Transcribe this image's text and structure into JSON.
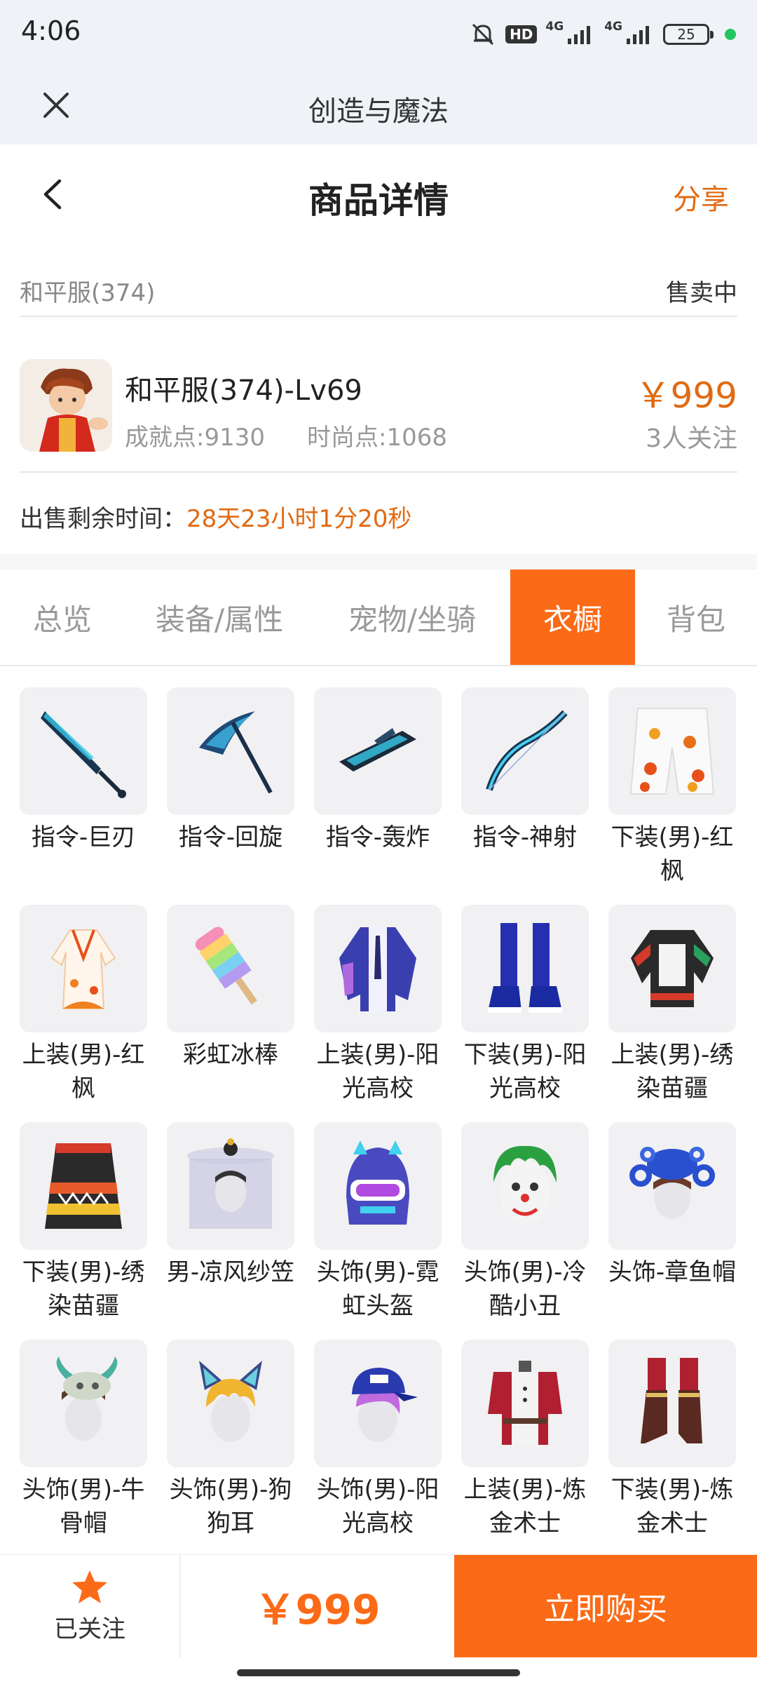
{
  "status_bar": {
    "time": "4:06",
    "hd_label": "HD",
    "network_1": "4G",
    "network_2": "4G",
    "battery": "25"
  },
  "web": {
    "title": "创造与魔法"
  },
  "header": {
    "title": "商品详情",
    "share_label": "分享"
  },
  "server": {
    "name": "和平服(374)",
    "status": "售卖中"
  },
  "product": {
    "name": "和平服(374)-Lv69",
    "achievement": "成就点:9130",
    "fashion": "时尚点:1068",
    "price": "￥999",
    "watchers": "3人关注"
  },
  "remaining": {
    "label": "出售剩余时间：",
    "value": "28天23小时1分20秒"
  },
  "tabs": [
    {
      "label": "总览"
    },
    {
      "label": "装备/属性"
    },
    {
      "label": "宠物/坐骑"
    },
    {
      "label": "衣橱"
    },
    {
      "label": "背包"
    }
  ],
  "items": [
    {
      "name": "指令-巨刃",
      "icon": "blade-icon"
    },
    {
      "name": "指令-回旋",
      "icon": "scythe-icon"
    },
    {
      "name": "指令-轰炸",
      "icon": "bomber-icon"
    },
    {
      "name": "指令-神射",
      "icon": "bow-icon"
    },
    {
      "name": "下装(男)-红枫",
      "icon": "maple-shorts-icon"
    },
    {
      "name": "上装(男)-红枫",
      "icon": "maple-robe-icon"
    },
    {
      "name": "彩虹冰棒",
      "icon": "rainbow-popsicle-icon"
    },
    {
      "name": "上装(男)-阳光高校",
      "icon": "school-jacket-icon"
    },
    {
      "name": "下装(男)-阳光高校",
      "icon": "school-boots-icon"
    },
    {
      "name": "上装(男)-绣染苗疆",
      "icon": "miao-top-icon"
    },
    {
      "name": "下装(男)-绣染苗疆",
      "icon": "miao-skirt-icon"
    },
    {
      "name": "男-凉风纱笠",
      "icon": "veil-hat-icon"
    },
    {
      "name": "头饰(男)-霓虹头盔",
      "icon": "neon-helmet-icon"
    },
    {
      "name": "头饰(男)-冷酷小丑",
      "icon": "clown-mask-icon"
    },
    {
      "name": "头饰-章鱼帽",
      "icon": "octopus-hat-icon"
    },
    {
      "name": "头饰(男)-牛骨帽",
      "icon": "bull-skull-hat-icon"
    },
    {
      "name": "头饰(男)-狗狗耳",
      "icon": "dog-ears-icon"
    },
    {
      "name": "头饰(男)-阳光高校",
      "icon": "school-cap-icon"
    },
    {
      "name": "上装(男)-炼金术士",
      "icon": "alchemist-top-icon"
    },
    {
      "name": "下装(男)-炼金术士",
      "icon": "alchemist-boots-icon"
    }
  ],
  "bottom": {
    "follow_label": "已关注",
    "price": "￥999",
    "buy_label": "立即购买"
  },
  "colors": {
    "accent": "#fb6a16",
    "price": "#e06a12",
    "header_bg": "#eff3f7"
  }
}
